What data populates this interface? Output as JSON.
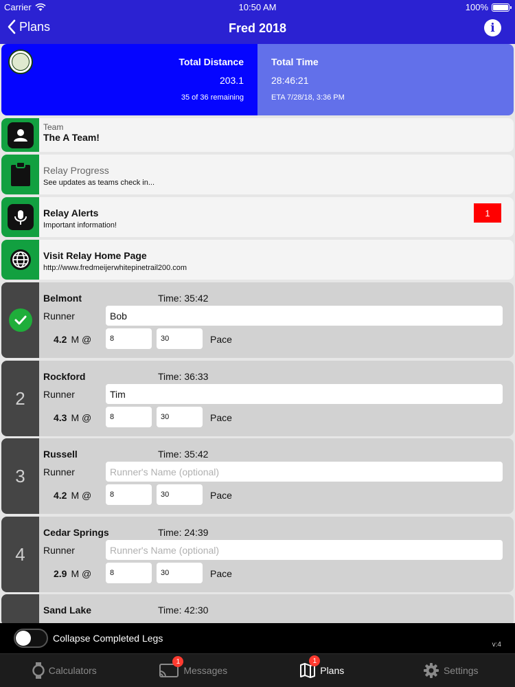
{
  "status_bar": {
    "carrier": "Carrier",
    "time": "10:50 AM",
    "battery": "100%"
  },
  "nav": {
    "back_label": "Plans",
    "title": "Fred 2018",
    "info_icon": "i"
  },
  "summary": {
    "total_distance_label": "Total Distance",
    "total_distance_value": "203.1",
    "remaining": "35 of 36 remaining",
    "total_time_label": "Total Time",
    "total_time_value": "28:46:21",
    "eta": "ETA 7/28/18, 3:36 PM"
  },
  "menu": {
    "team": {
      "small": "Team",
      "title": "The A Team!"
    },
    "progress": {
      "title": "Relay Progress",
      "sub": "See updates as teams check in..."
    },
    "alerts": {
      "title": "Relay Alerts",
      "sub": "Important information!",
      "badge": "1"
    },
    "home": {
      "title": "Visit Relay Home Page",
      "sub": "http://www.fredmeijerwhitepinetrail200.com"
    }
  },
  "legs": [
    {
      "number": "",
      "completed": true,
      "name": "Belmont",
      "time": "Time: 35:42",
      "runner_label": "Runner",
      "runner": "Bob",
      "placeholder": "Runner's Name (optional)",
      "distance": "4.2",
      "unit": "M @",
      "pace_min": "8",
      "pace_sec": "30",
      "pace_label": "Pace"
    },
    {
      "number": "2",
      "completed": false,
      "name": "Rockford",
      "time": "Time: 36:33",
      "runner_label": "Runner",
      "runner": "Tim",
      "placeholder": "Runner's Name (optional)",
      "distance": "4.3",
      "unit": "M @",
      "pace_min": "8",
      "pace_sec": "30",
      "pace_label": "Pace"
    },
    {
      "number": "3",
      "completed": false,
      "name": "Russell",
      "time": "Time: 35:42",
      "runner_label": "Runner",
      "runner": "",
      "placeholder": "Runner's Name (optional)",
      "distance": "4.2",
      "unit": "M @",
      "pace_min": "8",
      "pace_sec": "30",
      "pace_label": "Pace"
    },
    {
      "number": "4",
      "completed": false,
      "name": "Cedar Springs",
      "time": "Time: 24:39",
      "runner_label": "Runner",
      "runner": "",
      "placeholder": "Runner's Name (optional)",
      "distance": "2.9",
      "unit": "M @",
      "pace_min": "8",
      "pace_sec": "30",
      "pace_label": "Pace"
    },
    {
      "number": "",
      "completed": false,
      "name": "Sand Lake",
      "time": "Time: 42:30"
    }
  ],
  "collapse": {
    "label": "Collapse Completed Legs",
    "enabled": false,
    "version": "v:4"
  },
  "tabs": [
    {
      "label": "Calculators",
      "icon": "watch-icon",
      "badge": ""
    },
    {
      "label": "Messages",
      "icon": "cast-icon",
      "badge": "1"
    },
    {
      "label": "Plans",
      "icon": "map-icon",
      "badge": "1",
      "active": true
    },
    {
      "label": "Settings",
      "icon": "gear-icon",
      "badge": ""
    }
  ],
  "colors": {
    "header": "#2b22d2",
    "accent_green": "#12a040",
    "alert_red": "#ff0000"
  }
}
